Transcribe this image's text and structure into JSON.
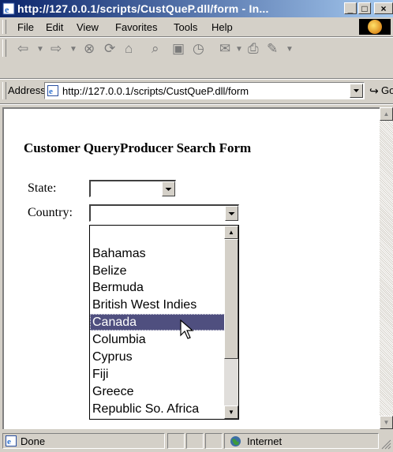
{
  "window": {
    "title": "http://127.0.0.1/scripts/CustQueP.dll/form - In...",
    "buttons": {
      "minimize": "_",
      "maximize": "□",
      "close": "×"
    }
  },
  "menu": [
    "File",
    "Edit",
    "View",
    "Favorites",
    "Tools",
    "Help"
  ],
  "toolbar": {
    "icons": [
      "back-icon",
      "forward-icon",
      "stop-icon",
      "refresh-icon",
      "home-icon",
      "search-icon",
      "favorites-icon",
      "history-icon",
      "mail-icon",
      "print-icon",
      "edit-icon"
    ]
  },
  "address": {
    "label": "Address",
    "url": "http://127.0.0.1/scripts/CustQueP.dll/form",
    "go_label": "Go"
  },
  "page": {
    "title": "Customer QueryProducer Search Form",
    "state_label": "State:",
    "state_value": "",
    "country_label": "Country:",
    "country_value": ""
  },
  "country_options": [
    {
      "label": "",
      "selected": false
    },
    {
      "label": "Bahamas",
      "selected": false
    },
    {
      "label": "Belize",
      "selected": false
    },
    {
      "label": "Bermuda",
      "selected": false
    },
    {
      "label": "British West Indies",
      "selected": false
    },
    {
      "label": "Canada",
      "selected": true
    },
    {
      "label": "Columbia",
      "selected": false
    },
    {
      "label": "Cyprus",
      "selected": false
    },
    {
      "label": "Fiji",
      "selected": false
    },
    {
      "label": "Greece",
      "selected": false
    },
    {
      "label": "Republic So. Africa",
      "selected": false
    }
  ],
  "status": {
    "text": "Done",
    "zone": "Internet"
  },
  "colors": {
    "title_bar_start": "#0a246a",
    "title_bar_end": "#a6caf0",
    "selection": "#4f4f7f",
    "chrome": "#d4d0c8"
  }
}
